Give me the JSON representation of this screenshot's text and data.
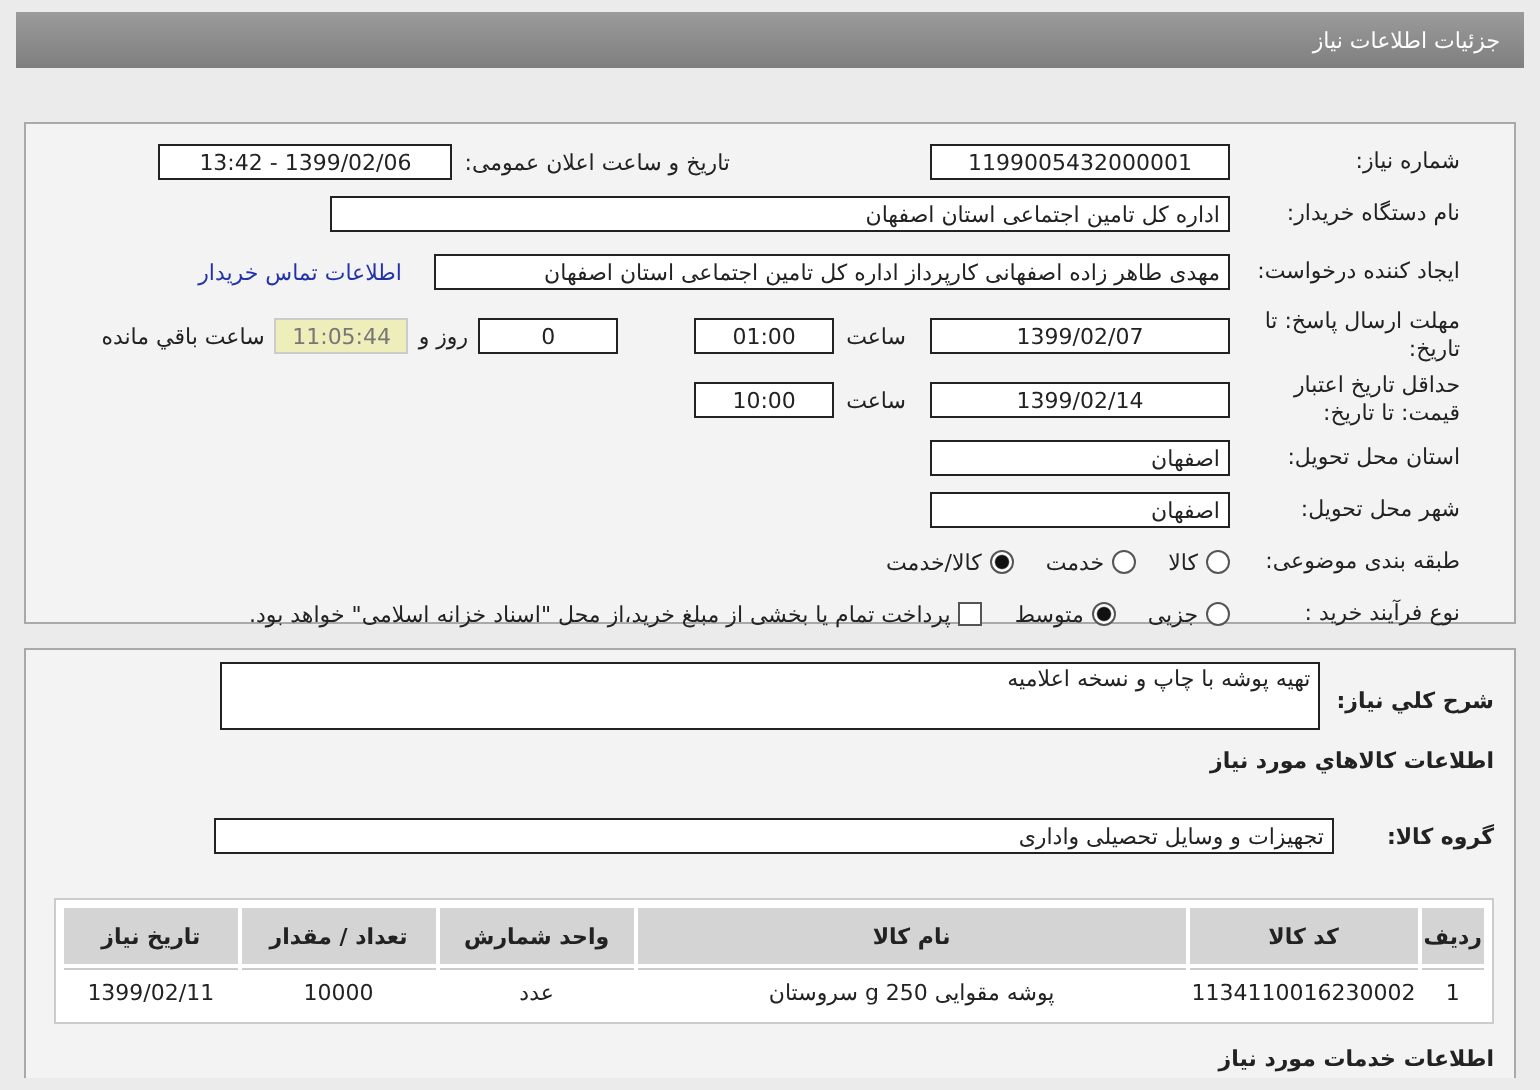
{
  "header": {
    "title": "جزئیات اطلاعات نیاز"
  },
  "details": {
    "need_number": {
      "label": "شماره نیاز:",
      "value": "1199005432000001"
    },
    "announce": {
      "label": "تاریخ و ساعت اعلان عمومی:",
      "value": "1399/02/06 - 13:42"
    },
    "buyer": {
      "label": "نام دستگاه خریدار:",
      "value": "اداره کل تامین اجتماعی استان اصفهان"
    },
    "requester": {
      "label": "ایجاد کننده درخواست:",
      "value": "مهدی طاهر زاده اصفهانی کارپرداز اداره کل تامین اجتماعی استان اصفهان",
      "link": "اطلاعات تماس خریدار"
    },
    "deadline": {
      "label": "مهلت ارسال پاسخ: تا تاریخ:",
      "date": "1399/02/07",
      "time_label": "ساعت",
      "time": "01:00",
      "days": "0",
      "days_label": "روز و",
      "remaining": "11:05:44",
      "remaining_label": "ساعت باقي مانده"
    },
    "validity": {
      "label": "حداقل تاریخ اعتبار قیمت: تا تاریخ:",
      "date": "1399/02/14",
      "time_label": "ساعت",
      "time": "10:00"
    },
    "province": {
      "label": "استان محل تحویل:",
      "value": "اصفهان"
    },
    "city": {
      "label": "شهر محل تحویل:",
      "value": "اصفهان"
    },
    "category": {
      "label": "طبقه بندی موضوعی:",
      "options": [
        {
          "label": "کالا",
          "selected": false
        },
        {
          "label": "خدمت",
          "selected": false
        },
        {
          "label": "کالا/خدمت",
          "selected": true
        }
      ]
    },
    "purchase_type": {
      "label": "نوع فرآیند خرید :",
      "options": [
        {
          "label": "جزیی",
          "selected": false
        },
        {
          "label": "متوسط",
          "selected": true
        }
      ],
      "treasury": {
        "label": "پرداخت تمام یا بخشی از مبلغ خرید،از محل \"اسناد خزانه اسلامی\" خواهد بود.",
        "checked": false
      }
    }
  },
  "summary": {
    "label": "شرح کلي نياز:",
    "value": "تهیه پوشه با چاپ و نسخه اعلامیه"
  },
  "goods_heading": "اطلاعات کالاهاي مورد نياز",
  "goods_group": {
    "label": "گروه کالا:",
    "value": "تجهیزات و وسایل تحصیلی واداری"
  },
  "table": {
    "columns": [
      "ردیف",
      "کد کالا",
      "نام کالا",
      "واحد شمارش",
      "تعداد / مقدار",
      "تاریخ نیاز"
    ],
    "rows": [
      [
        "1",
        "1134110016230002",
        "پوشه مقوایی 250 g سروستان",
        "عدد",
        "10000",
        "1399/02/11"
      ]
    ]
  },
  "services_heading": "اطلاعات خدمات مورد نياز"
}
